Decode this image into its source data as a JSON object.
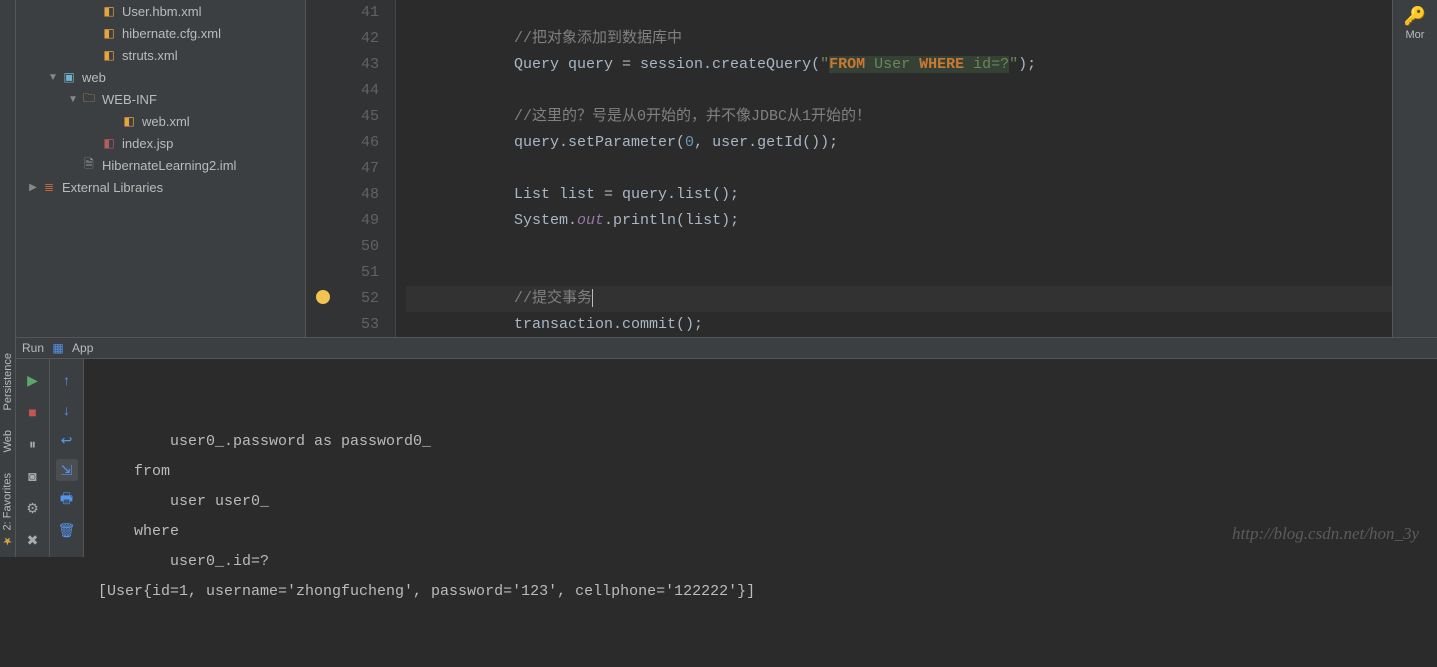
{
  "leftStrip": {
    "persistence": "Persistence",
    "web": "Web",
    "favorites": "2: Favorites"
  },
  "tree": [
    {
      "pad": "indent0",
      "arrow": "",
      "icon": "ic-xml",
      "glyph": "◧",
      "label": "User.hbm.xml"
    },
    {
      "pad": "indent0",
      "arrow": "",
      "icon": "ic-xml",
      "glyph": "◧",
      "label": "hibernate.cfg.xml"
    },
    {
      "pad": "indent0",
      "arrow": "",
      "icon": "ic-xml",
      "glyph": "◧",
      "label": "struts.xml"
    },
    {
      "pad": "indent1",
      "arrow": "open",
      "icon": "ic-web",
      "glyph": "▣",
      "label": "web"
    },
    {
      "pad": "indent2",
      "arrow": "open",
      "icon": "ic-folder",
      "glyph": "🗀",
      "label": "WEB-INF"
    },
    {
      "pad": "indent4",
      "arrow": "",
      "icon": "ic-xml",
      "glyph": "◧",
      "label": "web.xml"
    },
    {
      "pad": "indent3",
      "arrow": "",
      "icon": "ic-jsp",
      "glyph": "◧",
      "label": "index.jsp"
    },
    {
      "pad": "indent2",
      "arrow": "",
      "icon": "ic-iml",
      "glyph": "🗎",
      "label": "HibernateLearning2.iml"
    },
    {
      "pad": "indentL0",
      "arrow": "closed",
      "icon": "ic-lib",
      "glyph": "≣",
      "label": "External Libraries"
    }
  ],
  "rightStrip": {
    "label": "Mor"
  },
  "editor": {
    "startLine": 41,
    "bulbLine": 52,
    "caretLine": 52,
    "lines": [
      {
        "n": 41,
        "type": "blank"
      },
      {
        "n": 42,
        "type": "cmt",
        "text": "//把对象添加到数据库中"
      },
      {
        "n": 43,
        "type": "sql"
      },
      {
        "n": 44,
        "type": "blank"
      },
      {
        "n": 45,
        "type": "cmt",
        "text": "//这里的？号是从0开始的，并不像JDBC从1开始的！"
      },
      {
        "n": 46,
        "type": "param"
      },
      {
        "n": 47,
        "type": "blank"
      },
      {
        "n": 48,
        "type": "list"
      },
      {
        "n": 49,
        "type": "print"
      },
      {
        "n": 50,
        "type": "blank"
      },
      {
        "n": 51,
        "type": "blank"
      },
      {
        "n": 52,
        "type": "caret",
        "text": "//提交事务"
      },
      {
        "n": 53,
        "type": "commit"
      }
    ],
    "tokens": {
      "sql_pre": "Query query = session.createQuery(",
      "sql_q": "\"",
      "sql_from": "FROM",
      "sql_mid": " User ",
      "sql_where": "WHERE",
      "sql_end": " id=?",
      "sql_post": ");",
      "param": "query.setParameter(",
      "param_num": "0",
      "param_mid": ", user.getId());",
      "list": "List list = query.list();",
      "print_pre": "System.",
      "print_out": "out",
      "print_post": ".println(list);",
      "commit": "transaction.commit();"
    }
  },
  "runTab": {
    "label": "Run",
    "config": "App"
  },
  "console": [
    "        user0_.password as password0_ ",
    "    from",
    "        user user0_ ",
    "    where",
    "        user0_.id=?",
    "[User{id=1, username='zhongfucheng', password='123', cellphone='122222'}]"
  ],
  "watermark": "http://blog.csdn.net/hon_3y"
}
